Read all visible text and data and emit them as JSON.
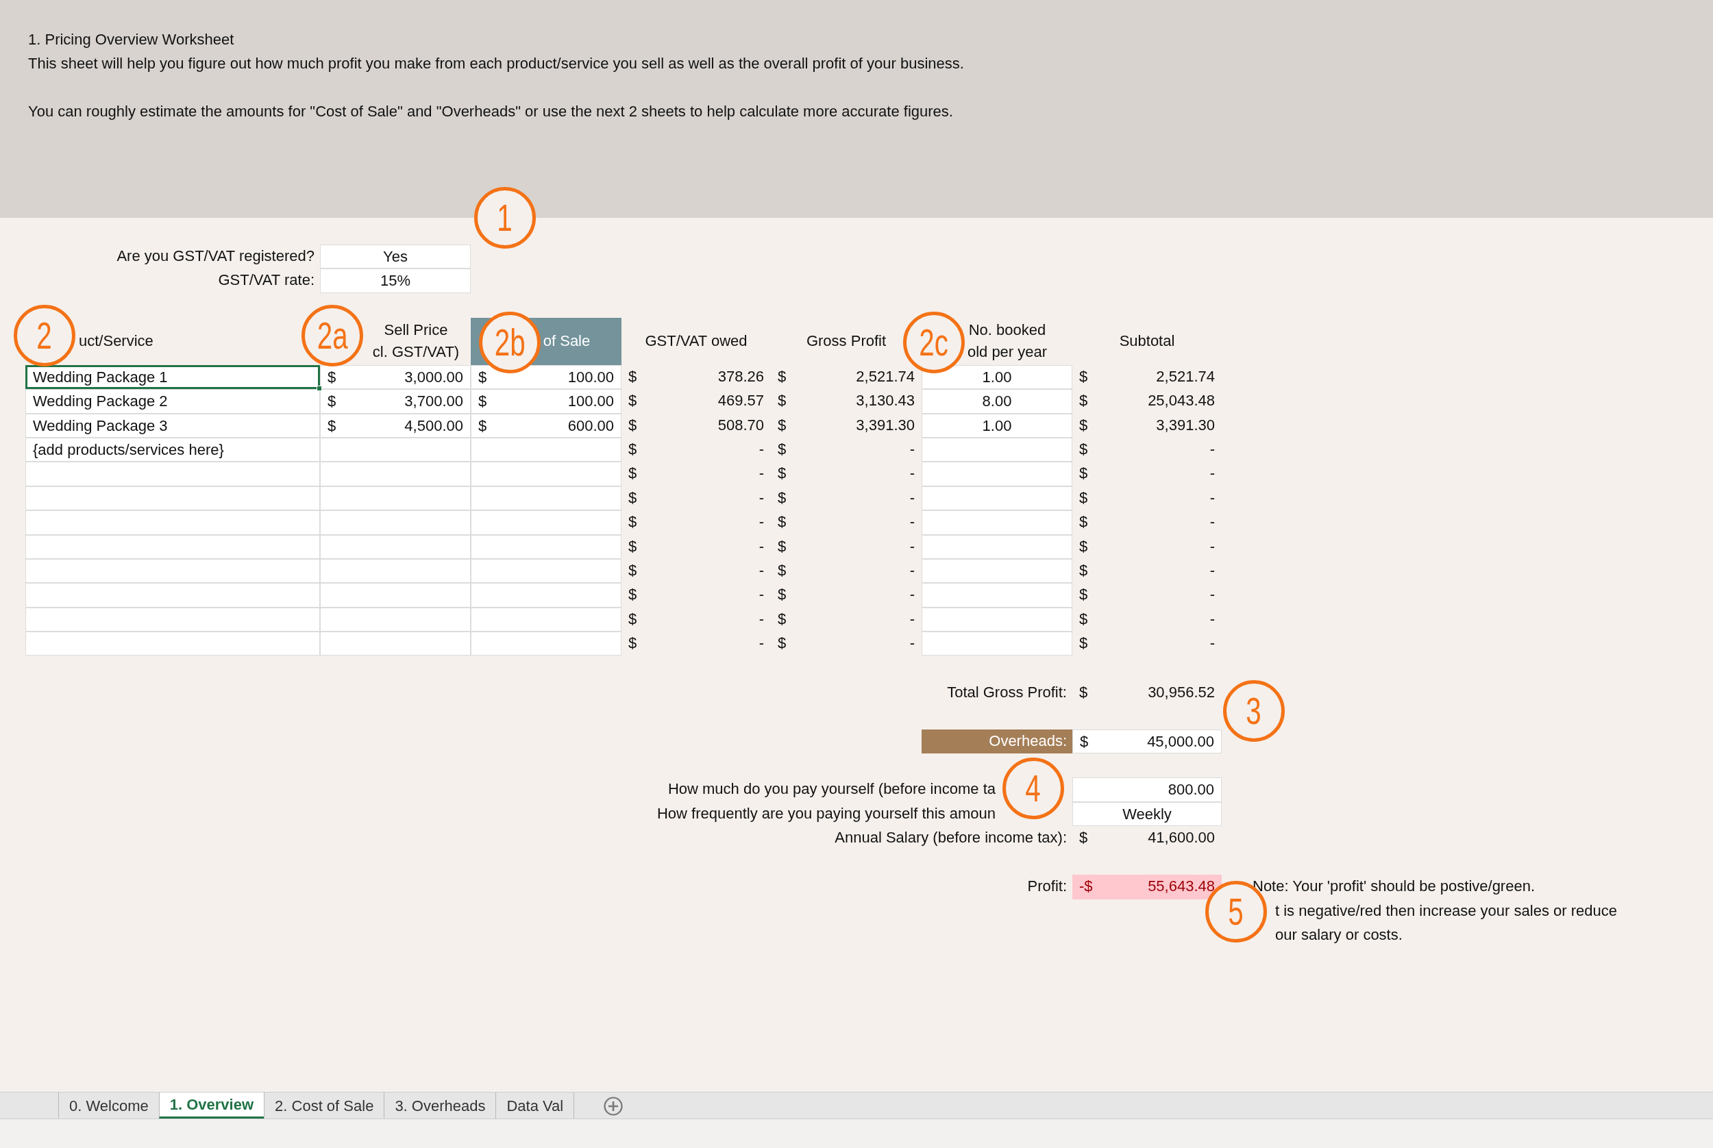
{
  "description": {
    "title": "1. Pricing Overview Worksheet",
    "lines": [
      "This sheet will help you figure out how much profit you make from each product/service you sell as well as the overall profit of your business.",
      "You can roughly estimate the amounts for \"Cost of Sale\" and \"Overheads\" or use the next 2 sheets to help calculate more accurate figures."
    ]
  },
  "gst": [
    {
      "label": "Are you GST/VAT registered?",
      "value": "Yes"
    },
    {
      "label": "GST/VAT rate:",
      "value": "15%"
    }
  ],
  "table": {
    "columns": [
      {
        "lines": [
          "uct/Service"
        ],
        "highlighted": false
      },
      {
        "lines": [
          "Sell Price",
          "cl. GST/VAT)"
        ],
        "highlighted": false
      },
      {
        "lines": [
          "of Sale"
        ],
        "highlighted": true
      },
      {
        "lines": [
          "GST/VAT owed"
        ],
        "highlighted": false
      },
      {
        "lines": [
          "Gross Profit"
        ],
        "highlighted": false
      },
      {
        "lines": [
          "No. booked",
          "old per year"
        ],
        "highlighted": false
      },
      {
        "lines": [
          "Subtotal"
        ],
        "highlighted": false
      }
    ],
    "rows": [
      {
        "name": "Wedding Package 1",
        "selected": true,
        "sell_price": {
          "currency": "$",
          "amount": "3,000.00"
        },
        "cost_of_sale": {
          "currency": "$",
          "amount": "100.00"
        },
        "gst_owed": {
          "currency": "$",
          "amount": "378.26"
        },
        "gross_profit": {
          "currency": "$",
          "amount": "2,521.74"
        },
        "booked": "1.00",
        "subtotal": {
          "currency": "$",
          "amount": "2,521.74"
        }
      },
      {
        "name": "Wedding Package 2",
        "selected": false,
        "sell_price": {
          "currency": "$",
          "amount": "3,700.00"
        },
        "cost_of_sale": {
          "currency": "$",
          "amount": "100.00"
        },
        "gst_owed": {
          "currency": "$",
          "amount": "469.57"
        },
        "gross_profit": {
          "currency": "$",
          "amount": "3,130.43"
        },
        "booked": "8.00",
        "subtotal": {
          "currency": "$",
          "amount": "25,043.48"
        }
      },
      {
        "name": "Wedding Package 3",
        "selected": false,
        "sell_price": {
          "currency": "$",
          "amount": "4,500.00"
        },
        "cost_of_sale": {
          "currency": "$",
          "amount": "600.00"
        },
        "gst_owed": {
          "currency": "$",
          "amount": "508.70"
        },
        "gross_profit": {
          "currency": "$",
          "amount": "3,391.30"
        },
        "booked": "1.00",
        "subtotal": {
          "currency": "$",
          "amount": "3,391.30"
        }
      },
      {
        "name": "{add products/services here}",
        "selected": false,
        "gst_owed": {
          "currency": "$",
          "amount": "-"
        },
        "gross_profit": {
          "currency": "$",
          "amount": "-"
        },
        "subtotal": {
          "currency": "$",
          "amount": "-"
        }
      },
      {
        "selected": false,
        "gst_owed": {
          "currency": "$",
          "amount": "-"
        },
        "gross_profit": {
          "currency": "$",
          "amount": "-"
        },
        "subtotal": {
          "currency": "$",
          "amount": "-"
        }
      },
      {
        "selected": false,
        "gst_owed": {
          "currency": "$",
          "amount": "-"
        },
        "gross_profit": {
          "currency": "$",
          "amount": "-"
        },
        "subtotal": {
          "currency": "$",
          "amount": "-"
        }
      },
      {
        "selected": false,
        "gst_owed": {
          "currency": "$",
          "amount": "-"
        },
        "gross_profit": {
          "currency": "$",
          "amount": "-"
        },
        "subtotal": {
          "currency": "$",
          "amount": "-"
        }
      },
      {
        "selected": false,
        "gst_owed": {
          "currency": "$",
          "amount": "-"
        },
        "gross_profit": {
          "currency": "$",
          "amount": "-"
        },
        "subtotal": {
          "currency": "$",
          "amount": "-"
        }
      },
      {
        "selected": false,
        "gst_owed": {
          "currency": "$",
          "amount": "-"
        },
        "gross_profit": {
          "currency": "$",
          "amount": "-"
        },
        "subtotal": {
          "currency": "$",
          "amount": "-"
        }
      },
      {
        "selected": false,
        "gst_owed": {
          "currency": "$",
          "amount": "-"
        },
        "gross_profit": {
          "currency": "$",
          "amount": "-"
        },
        "subtotal": {
          "currency": "$",
          "amount": "-"
        }
      },
      {
        "selected": false,
        "gst_owed": {
          "currency": "$",
          "amount": "-"
        },
        "gross_profit": {
          "currency": "$",
          "amount": "-"
        },
        "subtotal": {
          "currency": "$",
          "amount": "-"
        }
      },
      {
        "selected": false,
        "gst_owed": {
          "currency": "$",
          "amount": "-"
        },
        "gross_profit": {
          "currency": "$",
          "amount": "-"
        },
        "subtotal": {
          "currency": "$",
          "amount": "-"
        }
      }
    ]
  },
  "summary": {
    "total_gross_profit": {
      "label": "Total Gross Profit:",
      "currency": "$",
      "amount": "30,956.52"
    },
    "overheads": {
      "label": "Overheads:",
      "currency": "$",
      "amount": "45,000.00"
    },
    "pay_amount": {
      "label": "How much do you pay yourself (before income ta",
      "value": "800.00"
    },
    "pay_frequency": {
      "label": "How frequently are you paying yourself this amoun",
      "value": "Weekly"
    },
    "annual_salary": {
      "label": "Annual Salary (before income tax):",
      "currency": "$",
      "amount": "41,600.00"
    },
    "profit": {
      "label": "Profit:",
      "currency": "-$",
      "amount": "55,643.48",
      "negative": true
    }
  },
  "note": [
    "Note: Your 'profit' should be postive/green.",
    "t is negative/red then increase your sales or reduce",
    "our salary or costs."
  ],
  "callouts": [
    "1",
    "2",
    "2a",
    "2b",
    "2c",
    "3",
    "4",
    "5"
  ],
  "sheet_tabs": [
    {
      "label": "0. Welcome",
      "selected": false
    },
    {
      "label": "1. Overview",
      "selected": true
    },
    {
      "label": "2. Cost of Sale",
      "selected": false
    },
    {
      "label": "3. Overheads",
      "selected": false
    },
    {
      "label": "Data Val",
      "selected": false
    }
  ]
}
